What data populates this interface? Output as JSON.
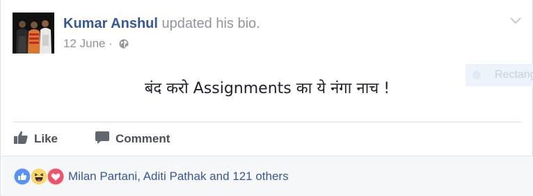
{
  "post": {
    "author_name": "Kumar Anshul",
    "action_text": "updated his bio.",
    "date": "12 June",
    "meta_separator": "·",
    "body_text": "बंद करो Assignments का ये नंगा नाच !",
    "ghost_label": "Rectang"
  },
  "actions": {
    "like_label": "Like",
    "comment_label": "Comment"
  },
  "footer": {
    "reaction_icons": [
      "like-icon",
      "haha-icon",
      "love-icon"
    ],
    "likers_text": "Milan Partani, Aditi Pathak and 121 others"
  },
  "colors": {
    "link_blue": "#365899",
    "meta_gray": "#90949c",
    "like_blue": "#5890ff",
    "love_red": "#f25268",
    "haha_yellow": "#fcd669"
  }
}
